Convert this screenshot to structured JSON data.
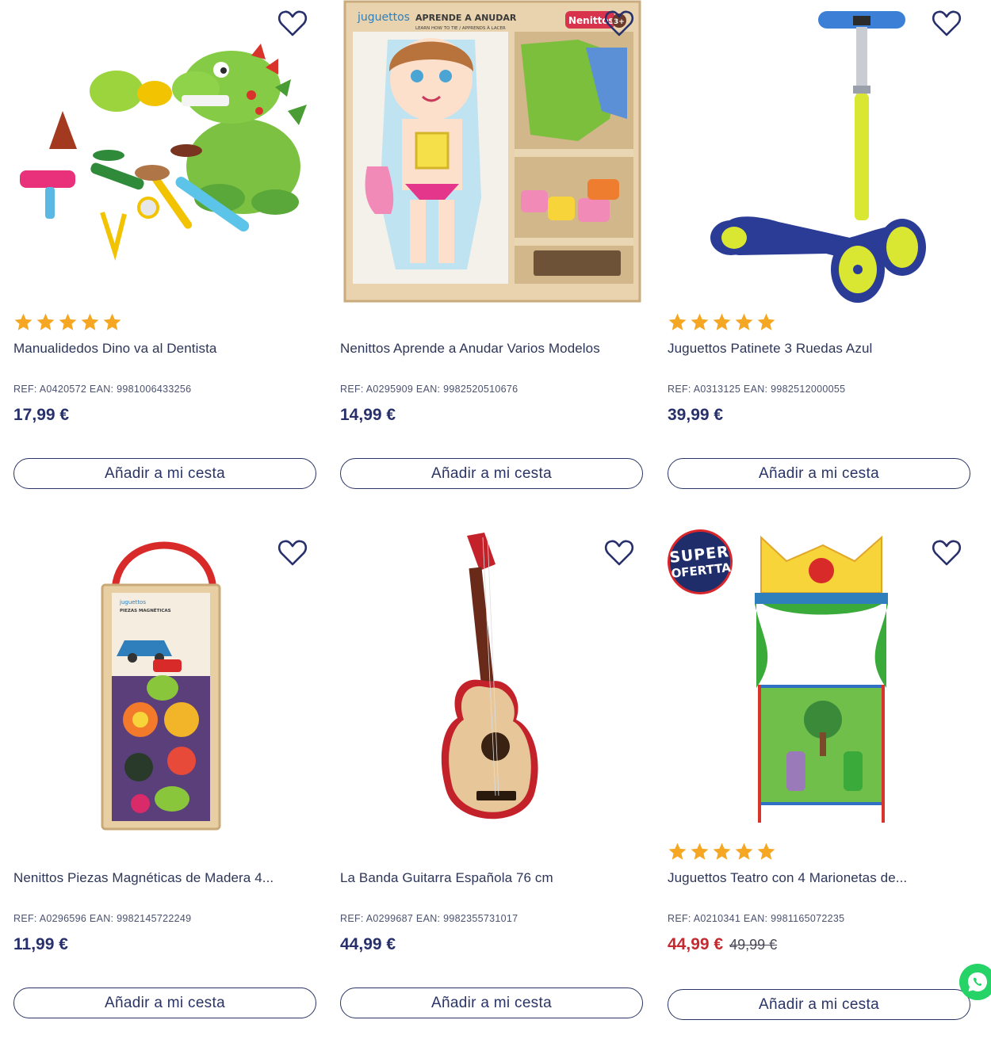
{
  "products": [
    {
      "title": "Manualidedos Dino va al Dentista",
      "ref": "REF: A0420572 EAN: 9981006433256",
      "price": "17,99 €",
      "old_price": "",
      "rating_stars": 5,
      "button_label": "Añadir a mi cesta",
      "image": "dino-dentist-playdough-set"
    },
    {
      "title": "Nenittos Aprende a Anudar Varios Modelos",
      "ref": "REF: A0295909 EAN: 9982520510676",
      "price": "14,99 €",
      "old_price": "",
      "rating_stars": 0,
      "button_label": "Añadir a mi cesta",
      "image": "wooden-lacing-doll-box",
      "box_texts": {
        "brand": "juguettos",
        "heading": "APRENDE A ANUDAR",
        "sub": "LEARN HOW TO TIE / APPRENDS À LACER",
        "label": "Nenittos",
        "age": "3+"
      }
    },
    {
      "title": "Juguettos Patinete 3 Ruedas Azul",
      "ref": "REF: A0313125 EAN: 9982512000055",
      "price": "39,99 €",
      "old_price": "",
      "rating_stars": 5,
      "button_label": "Añadir a mi cesta",
      "image": "blue-three-wheel-scooter"
    },
    {
      "title": "Nenittos Piezas Magnéticas de Madera 4...",
      "ref": "REF: A0296596 EAN: 9982145722249",
      "price": "11,99 €",
      "old_price": "",
      "rating_stars": 0,
      "button_label": "Añadir a mi cesta",
      "image": "magnetic-wooden-pieces-box",
      "box_texts": {
        "brand": "juguettos",
        "heading": "PIEZAS MAGNÉTICAS"
      }
    },
    {
      "title": "La Banda Guitarra Española 76 cm",
      "ref": "REF: A0299687 EAN: 9982355731017",
      "price": "44,99 €",
      "old_price": "",
      "rating_stars": 0,
      "button_label": "Añadir a mi cesta",
      "image": "spanish-guitar"
    },
    {
      "title": "Juguettos Teatro con 4 Marionetas de...",
      "ref": "REF: A0210341 EAN: 9981165072235",
      "price": "44,99 €",
      "old_price": "49,99 €",
      "rating_stars": 5,
      "button_label": "Añadir a mi cesta",
      "image": "puppet-theatre",
      "badge": {
        "line1": "SUPER",
        "line2": "OFERTTA"
      }
    }
  ],
  "colors": {
    "primary": "#27306b",
    "sale": "#c42b31",
    "star": "#f5a623",
    "whatsapp": "#25d366"
  },
  "icons": [
    "heart-icon",
    "star-icon",
    "whatsapp-icon"
  ]
}
